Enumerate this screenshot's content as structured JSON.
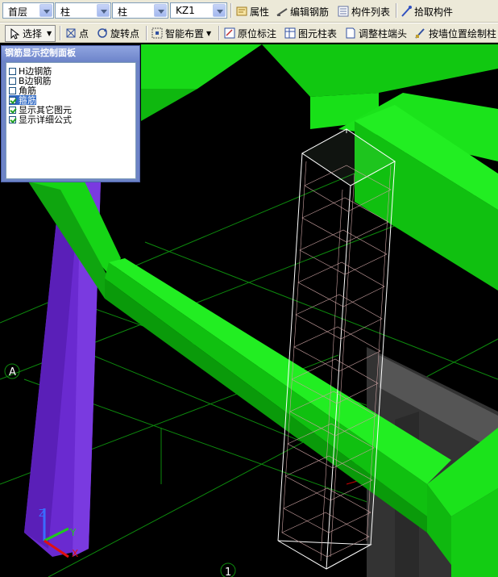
{
  "toolbar1": {
    "floor_value": "首层",
    "category_value": "柱",
    "type_value": "柱",
    "component_value": "KZ1",
    "property_label": "属性",
    "edit_rebar_label": "编辑钢筋",
    "component_list_label": "构件列表",
    "pick_component_label": "拾取构件"
  },
  "toolbar2": {
    "select_label": "选择",
    "point_label": "点",
    "rotate_point_label": "旋转点",
    "smart_layout_label": "智能布置",
    "original_mark_label": "原位标注",
    "column_table_label": "图元柱表",
    "adjust_column_end_label": "调整柱端头",
    "draw_by_wall_label": "按墙位置绘制柱"
  },
  "panel": {
    "title": "钢筋显示控制面板",
    "options": [
      {
        "label": "H边钢筋",
        "checked": false
      },
      {
        "label": "B边钢筋",
        "checked": false
      },
      {
        "label": "角筋",
        "checked": false
      },
      {
        "label": "箍筋",
        "checked": true,
        "selected": true
      },
      {
        "label": "显示其它图元",
        "checked": true
      },
      {
        "label": "显示详细公式",
        "checked": true
      }
    ]
  },
  "viewport": {
    "axis_label_a": "A",
    "axis_label_1": "1",
    "axis_x": "X",
    "axis_y": "Y",
    "axis_z": "Z",
    "colors": {
      "beam": "#19e619",
      "column_purple": "#6622cc",
      "grid": "#0b8a0b",
      "background": "#000000"
    }
  }
}
